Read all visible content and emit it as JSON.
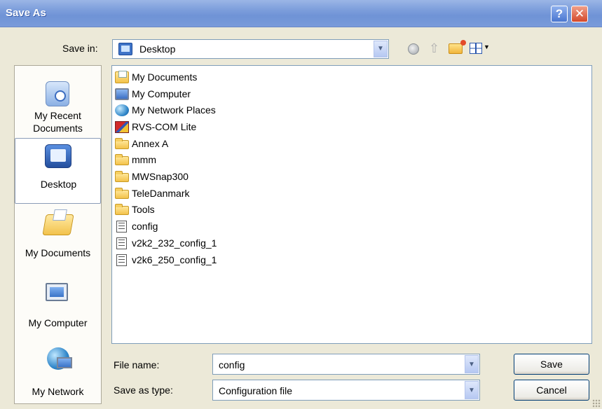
{
  "window": {
    "title": "Save As",
    "help_label": "?",
    "close_label": "✕"
  },
  "toolbar": {
    "save_in_label": "Save in:",
    "save_in_value": "Desktop",
    "icons": [
      "back-icon",
      "up-folder-icon",
      "new-folder-icon",
      "views-menu-icon"
    ]
  },
  "places": [
    {
      "label": "My Recent Documents",
      "icon": "recent-documents-icon"
    },
    {
      "label": "Desktop",
      "icon": "desktop-icon",
      "selected": true
    },
    {
      "label": "My Documents",
      "icon": "my-documents-icon"
    },
    {
      "label": "My Computer",
      "icon": "my-computer-icon"
    },
    {
      "label": "My Network",
      "icon": "my-network-icon"
    }
  ],
  "files": [
    {
      "name": "My Documents",
      "icon": "my-documents-icon"
    },
    {
      "name": "My Computer",
      "icon": "my-computer-icon"
    },
    {
      "name": "My Network Places",
      "icon": "network-places-icon"
    },
    {
      "name": "RVS-COM Lite",
      "icon": "application-icon"
    },
    {
      "name": "Annex A",
      "icon": "folder-icon"
    },
    {
      "name": "mmm",
      "icon": "folder-icon"
    },
    {
      "name": "MWSnap300",
      "icon": "folder-icon"
    },
    {
      "name": "TeleDanmark",
      "icon": "folder-icon"
    },
    {
      "name": "Tools",
      "icon": "folder-icon"
    },
    {
      "name": "config",
      "icon": "text-file-icon"
    },
    {
      "name": "v2k2_232_config_1",
      "icon": "text-file-icon"
    },
    {
      "name": "v2k6_250_config_1",
      "icon": "text-file-icon"
    }
  ],
  "form": {
    "file_name_label": "File name:",
    "file_name_value": "config",
    "save_as_type_label": "Save as type:",
    "save_as_type_value": "Configuration file"
  },
  "buttons": {
    "save_label": "Save",
    "cancel_label": "Cancel"
  },
  "colors": {
    "titlebar": "#7e9fdc",
    "dialog_bg": "#ece9d8",
    "close_button": "#d4482a"
  }
}
